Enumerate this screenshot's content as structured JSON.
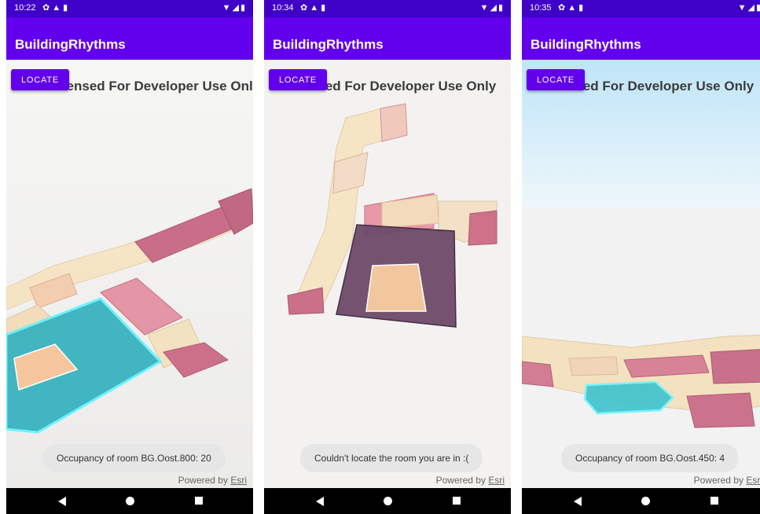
{
  "screens": [
    {
      "status_time": "10:22",
      "app_title": "BuildingRhythms",
      "locate_label": "LOCATE",
      "banner_text": "Licensed For Developer Use Only",
      "toast_text": "Occupancy of room BG.Oost.800: 20",
      "powered_by": "Powered by",
      "esri_link": "Esri"
    },
    {
      "status_time": "10:34",
      "app_title": "BuildingRhythms",
      "locate_label": "LOCATE",
      "banner_text": "Licensed For Developer Use Only",
      "toast_text": "Couldn't locate the room you are in :(",
      "powered_by": "Powered by",
      "esri_link": "Esri"
    },
    {
      "status_time": "10:35",
      "app_title": "BuildingRhythms",
      "locate_label": "LOCATE",
      "banner_text": "Licensed For Developer Use Only",
      "toast_text": "Occupancy of room BG.Oost.450: 4",
      "powered_by": "Powered by",
      "esri_link": "Esri"
    }
  ],
  "colors": {
    "status_bar": "#3f00c7",
    "app_bar": "#6200ee",
    "selected_room": "#2bb3c0",
    "occupied_room": "#c0506e",
    "building": "#f5deb0"
  },
  "icons": [
    "settings-icon",
    "warning-icon",
    "sd-card-icon",
    "wifi-icon",
    "signal-icon",
    "battery-icon",
    "back-icon",
    "home-icon",
    "recents-icon"
  ]
}
